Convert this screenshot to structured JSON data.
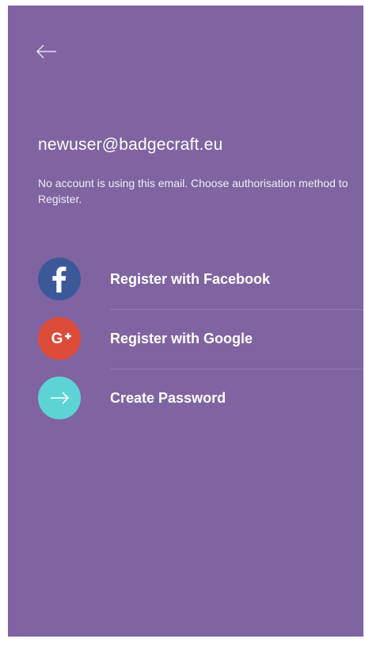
{
  "screen": {
    "email": "newuser@badgecraft.eu",
    "message": "No account is using this email. Choose authorisation method to Register."
  },
  "options": [
    {
      "label": "Register with Facebook",
      "icon": "facebook-icon",
      "color": "#3B5998"
    },
    {
      "label": "Register with Google",
      "icon": "google-plus-icon",
      "color": "#DD4B39"
    },
    {
      "label": "Create Password",
      "icon": "arrow-right-icon",
      "color": "#5DD3D3"
    }
  ],
  "colors": {
    "background": "#8064A2",
    "text": "#FFFFFF"
  }
}
